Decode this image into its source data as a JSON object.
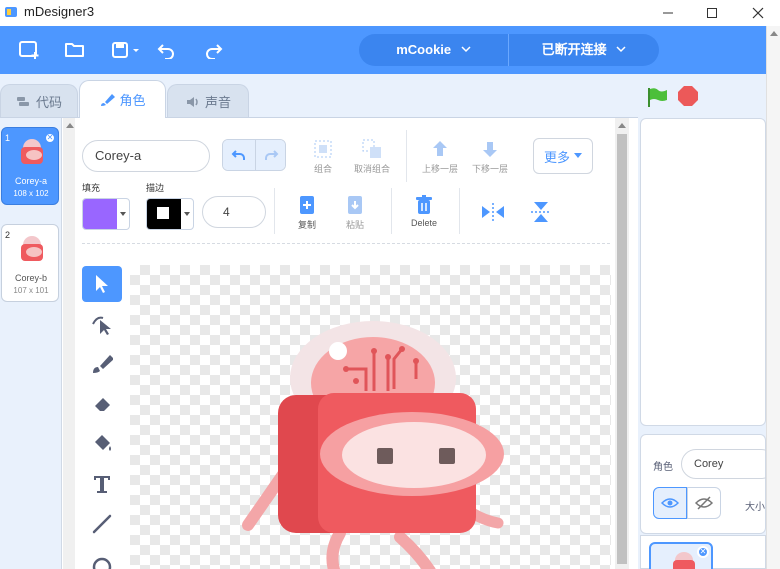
{
  "app": {
    "title": "mDesigner3"
  },
  "device": {
    "name": "mCookie",
    "status": "已断开连接"
  },
  "tabs": [
    {
      "label": "代码"
    },
    {
      "label": "角色"
    },
    {
      "label": "声音"
    }
  ],
  "costumes": [
    {
      "index": "1",
      "name": "Corey-a",
      "size": "108 x 102"
    },
    {
      "index": "2",
      "name": "Corey-b",
      "size": "107 x 101"
    }
  ],
  "editor": {
    "costume_name": "Corey-a",
    "fill_label": "填充",
    "stroke_label": "描边",
    "stroke_width": "4",
    "fill_color": "#9966ff",
    "stroke_color": "#000000",
    "tools_top": {
      "group": "组合",
      "ungroup": "取消组合",
      "forward": "上移一层",
      "backward": "下移一层",
      "more": "更多"
    },
    "tools_bottom": {
      "copy": "复制",
      "paste": "粘贴",
      "delete": "Delete"
    }
  },
  "sprite": {
    "label": "角色",
    "name": "Corey",
    "size_label": "大小"
  },
  "colors": {
    "accent": "#4d97ff",
    "menubar": "#4d97ff"
  }
}
